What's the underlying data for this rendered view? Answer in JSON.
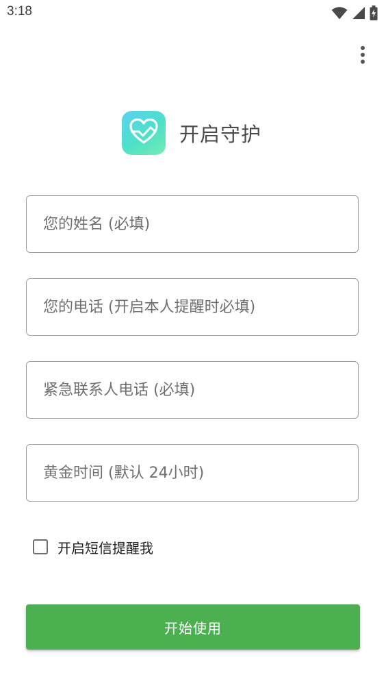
{
  "status_bar": {
    "time": "3:18",
    "icons": [
      "wifi-icon",
      "cell-signal-icon",
      "battery-charging-icon"
    ]
  },
  "toolbar": {
    "menu_icon": "more-vert-icon"
  },
  "header": {
    "logo_icon": "heart-check-icon",
    "title": "开启守护"
  },
  "form": {
    "name": {
      "value": "",
      "placeholder": "您的姓名 (必填)"
    },
    "phone": {
      "value": "",
      "placeholder": "您的电话 (开启本人提醒时必填)"
    },
    "emergency_phone": {
      "value": "",
      "placeholder": "紧急联系人电话 (必填)"
    },
    "golden_time": {
      "value": "",
      "placeholder": "黄金时间 (默认 24小时)"
    },
    "sms_reminder": {
      "label": "开启短信提醒我",
      "checked": false
    }
  },
  "actions": {
    "start_label": "开始使用"
  },
  "colors": {
    "primary": "#4caf50",
    "logo_gradient_start": "#5bd2f0",
    "logo_gradient_end": "#74ecb5",
    "field_border": "#9e9e9e"
  }
}
